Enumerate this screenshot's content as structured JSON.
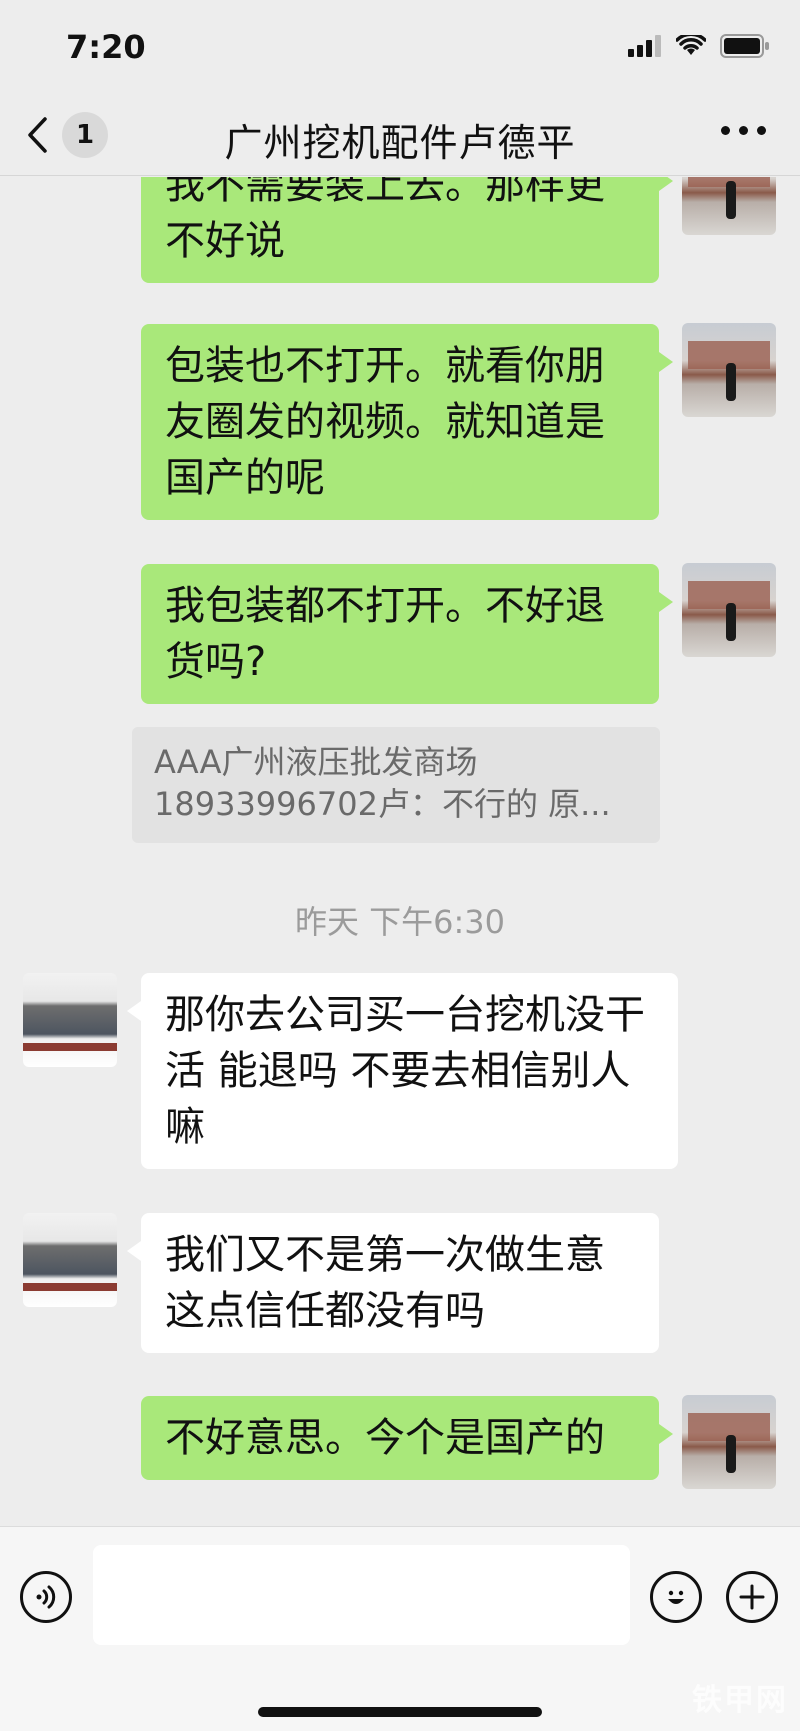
{
  "status_bar": {
    "time": "7:20"
  },
  "nav": {
    "back_count": "1",
    "title": "广州挖机配件卢德平"
  },
  "messages": [
    {
      "side": "me",
      "text": "我不需要装上去。那样更不好说"
    },
    {
      "side": "me",
      "text": "包装也不打开。就看你朋友圈发的视频。就知道是国产的呢"
    },
    {
      "side": "me",
      "text": "我包装都不打开。不好退货吗?"
    },
    {
      "side": "other",
      "text": "那你去公司买一台挖机没干活 能退吗 不要去相信别人嘛"
    },
    {
      "side": "other",
      "text": "我们又不是第一次做生意 这点信任都没有吗"
    },
    {
      "side": "me",
      "text": "不好意思。今个是国产的"
    }
  ],
  "quote": {
    "line1": "AAA广州液压批发商场",
    "line2": "18933996702卢：不行的 原..."
  },
  "timestamp": "昨天 下午6:30",
  "input": {
    "placeholder": ""
  },
  "watermark": "铁甲网"
}
